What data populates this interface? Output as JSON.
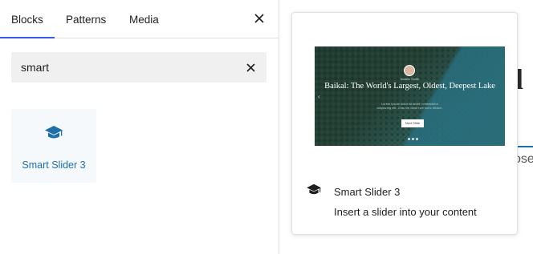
{
  "tabs": [
    {
      "label": "Blocks",
      "active": true
    },
    {
      "label": "Patterns",
      "active": false
    },
    {
      "label": "Media",
      "active": false
    }
  ],
  "search": {
    "value": "smart"
  },
  "results": [
    {
      "label": "Smart Slider 3",
      "icon": "graduation-cap-icon"
    }
  ],
  "preview": {
    "block_name": "Smart Slider 3",
    "block_description": "Insert a slider into your content",
    "slide": {
      "author": "Natalie Smith",
      "title": "Baikal: The World's Largest, Oldest, Deepest Lake",
      "description": "Lorem ipsum dolor sit amet, consectetur adipiscing elit. Cras vel dolor nec nunc dictum.",
      "button_label": "Next Slide",
      "dots": 3
    }
  },
  "background": {
    "title_fragment": "tl",
    "word_fragment": "ose"
  },
  "colors": {
    "accent": "#3858e9",
    "link": "#1e6fa8",
    "result_bg": "#f5f9fc",
    "input_bg": "#f0f0f0"
  }
}
